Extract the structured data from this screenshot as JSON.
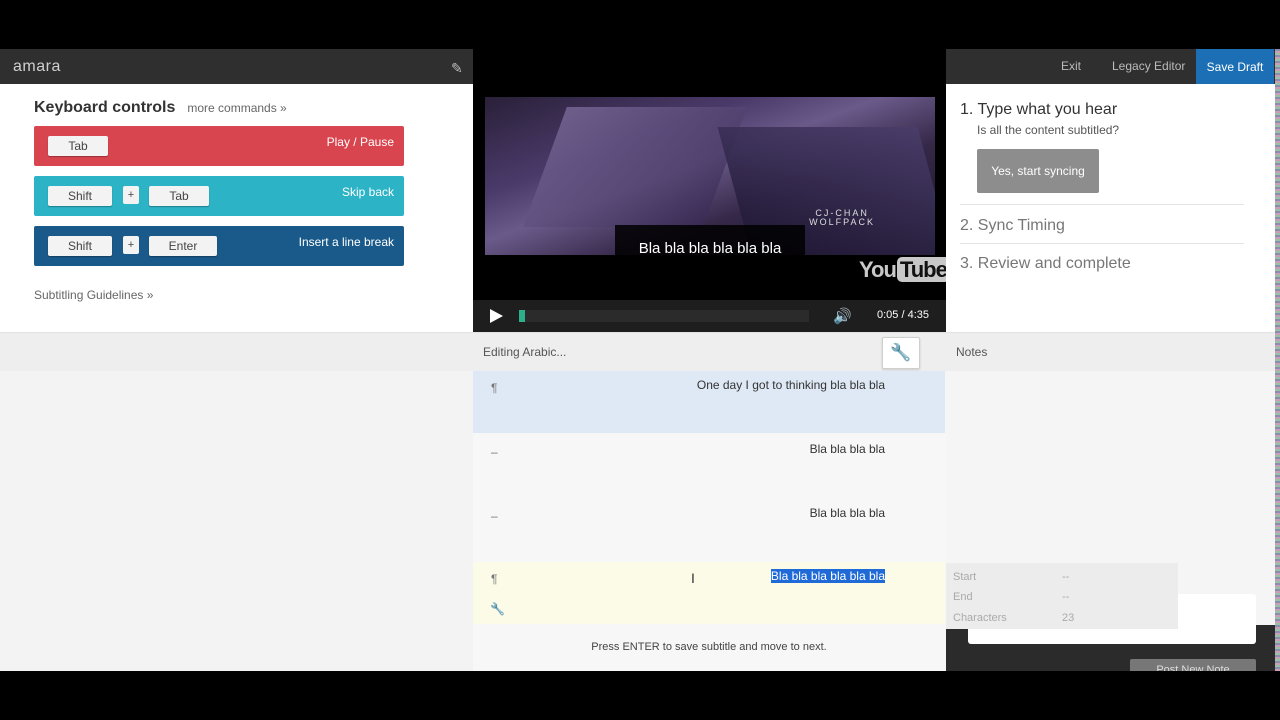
{
  "left_panel": {
    "logo": "amara",
    "keyboard_title": "Keyboard controls",
    "more_commands": "more commands »",
    "shortcuts": [
      {
        "keys": [
          "Tab"
        ],
        "action": "Play / Pause",
        "color": "#d9454e"
      },
      {
        "keys": [
          "Shift",
          "+",
          "Tab"
        ],
        "action": "Skip back",
        "color": "#2cb3c6"
      },
      {
        "keys": [
          "Shift",
          "+",
          "Enter"
        ],
        "action": "Insert a line break",
        "color": "#1a5a8a"
      }
    ],
    "guidelines_link": "Subtitling Guidelines »"
  },
  "video": {
    "watermark_line1": "CJ-CHAN",
    "watermark_line2": "WOLFPACK",
    "subtitle": "Bla bla bla bla bla bla",
    "provider_logo_you": "You",
    "provider_logo_tube": "Tube",
    "time": "0:05 / 4:35",
    "progress_fraction": 0.018,
    "progress_color": "#2bb08a"
  },
  "top_nav": {
    "exit": "Exit",
    "legacy_editor": "Legacy Editor",
    "save_draft": "Save Draft",
    "save_color": "#1c6fb4"
  },
  "steps": {
    "step1": "1. Type what you hear",
    "step1_question": "Is all the content subtitled?",
    "step1_button": "Yes, start syncing",
    "step2": "2. Sync Timing",
    "step3": "3. Review and complete"
  },
  "editor": {
    "header": "Editing Arabic...",
    "rows": [
      {
        "marker": "¶",
        "text": "One day I got to thinking bla bla bla"
      },
      {
        "marker": "–",
        "text": "Bla bla bla bla"
      },
      {
        "marker": "–",
        "text": "Bla bla bla bla"
      },
      {
        "marker": "¶",
        "text": "Bla bla bla bla bla bla"
      }
    ],
    "hint": "Press ENTER to save subtitle and move to next."
  },
  "notes": {
    "header": "Notes",
    "info": [
      {
        "label": "Start",
        "value": "--"
      },
      {
        "label": "End",
        "value": "--"
      },
      {
        "label": "Characters",
        "value": "23"
      }
    ],
    "post_button": "Post New Note"
  }
}
